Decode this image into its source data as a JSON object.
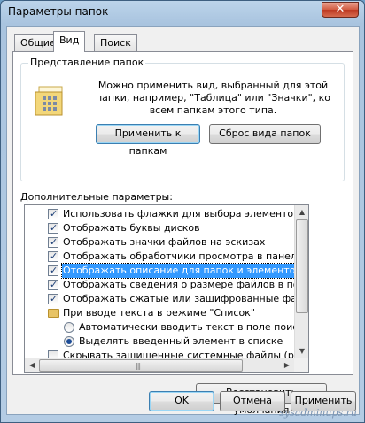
{
  "window": {
    "title": "Параметры папок",
    "close_label": "✕"
  },
  "tabs": [
    {
      "label": "Общие",
      "active": false
    },
    {
      "label": "Вид",
      "active": true
    },
    {
      "label": "Поиск",
      "active": false
    }
  ],
  "folder_views": {
    "title": "Представление папок",
    "description": "Можно применить вид, выбранный для этой папки, например, \"Таблица\" или \"Значки\", ко всем папкам этого типа.",
    "apply_button": "Применить к папкам",
    "reset_button": "Сброс вида папок",
    "icon": "folder-grid-icon"
  },
  "advanced": {
    "label": "Дополнительные параметры:",
    "items": [
      {
        "type": "checkbox",
        "checked": true,
        "label": "Использовать флажки для выбора элементов"
      },
      {
        "type": "checkbox",
        "checked": true,
        "label": "Отображать буквы дисков"
      },
      {
        "type": "checkbox",
        "checked": true,
        "label": "Отображать значки файлов на эскизах"
      },
      {
        "type": "checkbox",
        "checked": true,
        "label": "Отображать обработчики просмотра в панели просм"
      },
      {
        "type": "checkbox",
        "checked": true,
        "label": "Отображать описание для папок и элементов рабоче",
        "selected": true
      },
      {
        "type": "checkbox",
        "checked": true,
        "label": "Отображать сведения о размере файлов в подсказк"
      },
      {
        "type": "checkbox",
        "checked": true,
        "label": "Отображать сжатые или зашифрованные файлы NTI"
      },
      {
        "type": "folder",
        "label": "При вводе текста в режиме \"Список\""
      },
      {
        "type": "radio",
        "checked": false,
        "label": "Автоматически вводить текст в поле поиска"
      },
      {
        "type": "radio",
        "checked": true,
        "label": "Выделять введенный элемент в списке"
      },
      {
        "type": "checkbox",
        "checked": false,
        "label": "Скрывать защищенные системные файлы (рекомен"
      }
    ],
    "restore_button": "Восстановить умолчания"
  },
  "dialog_buttons": {
    "ok": "OK",
    "cancel": "Отмена",
    "apply": "Применить"
  },
  "watermark": "sysadminups.ru",
  "colors": {
    "selection": "#3399ff",
    "titlebar": "#b4cce4",
    "close": "#d05a40"
  }
}
